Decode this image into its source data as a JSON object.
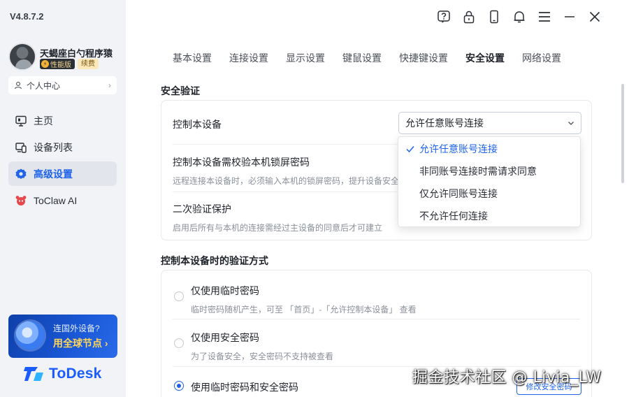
{
  "app": {
    "version": "V4.8.7.2",
    "brand_name": "ToDesk"
  },
  "user": {
    "name": "天蝎座白勺程序猿",
    "badge_perf": "性能版",
    "badge_renew": "续费",
    "personal_center": "个人中心"
  },
  "sidebar": {
    "items": [
      {
        "label": "主页",
        "icon": "monitor-icon",
        "active": false
      },
      {
        "label": "设备列表",
        "icon": "devices-icon",
        "active": false
      },
      {
        "label": "高级设置",
        "icon": "gear-icon",
        "active": true
      },
      {
        "label": "ToClaw AI",
        "icon": "claw-icon",
        "active": false
      }
    ],
    "promo": {
      "line1": "连国外设备?",
      "line2": "用全球节点 ›"
    }
  },
  "topbar": {
    "icons": [
      "help-icon",
      "lock-icon",
      "phone-icon",
      "bell-icon",
      "menu-icon",
      "minimize-icon",
      "close-icon"
    ]
  },
  "tabs": [
    "基本设置",
    "连接设置",
    "显示设置",
    "键鼠设置",
    "快捷键设置",
    "安全设置",
    "网络设置"
  ],
  "active_tab": "安全设置",
  "security": {
    "section_title": "安全验证",
    "control_device": {
      "label": "控制本设备",
      "selected": "允许任意账号连接",
      "options": [
        "允许任意账号连接",
        "非同账号连接时需请求同意",
        "仅允许同账号连接",
        "不允许任何连接"
      ]
    },
    "lock_password": {
      "title": "控制本设备需校验本机锁屏密码",
      "desc": "远程连接本设备时，必须输入本机的锁屏密码，提升设备安全"
    },
    "second_verify": {
      "title": "二次验证保护",
      "desc": "启用后所有与本机的连接需经过主设备的同意后才可建立"
    }
  },
  "verify_method": {
    "section_title": "控制本设备时的验证方式",
    "options": [
      {
        "title": "仅使用临时密码",
        "desc": "临时密码随机产生，可至 「首页」-「允许控制本设备」 查看",
        "checked": false
      },
      {
        "title": "仅使用安全密码",
        "desc": "为了设备安全，安全密码不支持被查看",
        "checked": false
      },
      {
        "title": "使用临时密码和安全密码",
        "desc": "",
        "checked": true
      }
    ],
    "modify_button": "修改安全密码"
  },
  "watermark": "掘金技术社区 @ Livia_LW",
  "colors": {
    "accent": "#1e63e9",
    "sidebar_bg": "#f1f3f7",
    "promo_gold": "#ffd65a"
  }
}
